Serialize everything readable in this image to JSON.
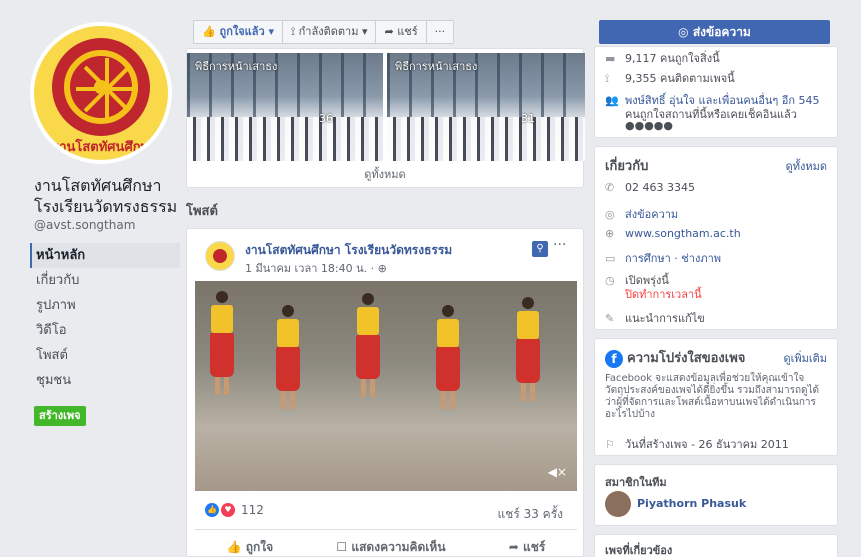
{
  "page": {
    "name_line1": "งานโสตทัศนศึกษา",
    "name_line2": "โรงเรียนวัดทรงธรรม",
    "handle": "@avst.songtham",
    "avatar_caption": "งานโสตทัศนศึกษ"
  },
  "nav": {
    "items": [
      {
        "label": "หน้าหลัก"
      },
      {
        "label": "เกี่ยวกับ"
      },
      {
        "label": "รูปภาพ"
      },
      {
        "label": "วิดีโอ"
      },
      {
        "label": "โพสต์"
      },
      {
        "label": "ชุมชน"
      }
    ],
    "create_page": "สร้างเพจ"
  },
  "action_bar": {
    "liked": "ถูกใจแล้ว ▾",
    "following": "กำลังติดตาม ▾",
    "share": "แชร์",
    "more": "···"
  },
  "photos": {
    "items": [
      {
        "caption": "พิธีการหน้าเสาธง",
        "count": "36"
      },
      {
        "caption": "พิธีการหน้าเสาธง",
        "count": "31"
      }
    ],
    "see_all": "ดูทั้งหมด"
  },
  "posts": {
    "header": "โพสต์",
    "author": "งานโสตทัศนศึกษา โรงเรียนวัดทรงธรรม",
    "time": "1 มีนาคม เวลา 18:40 น. · ",
    "reactions": "112",
    "shares": "แชร์ 33 ครั้ง",
    "actions": [
      "ถูกใจ",
      "แสดงความคิดเห็น",
      "แชร์"
    ]
  },
  "right": {
    "send_message": "ส่งข้อความ",
    "likes": "9,117 คนถูกใจสิ่งนี้",
    "followers": "9,355 คนติดตามเพจนี้",
    "friends_line1": "พงษ์สิทธิ์ อุ่นใจ และเพื่อนคนอื่นๆ อีก 545",
    "friends_line2": "คนถูกใจสถานที่นี้หรือเคยเช็คอินแล้ว",
    "about": {
      "title": "เกี่ยวกับ",
      "see_all": "ดูทั้งหมด",
      "phone": "02 463 3345",
      "message": "ส่งข้อความ",
      "website": "www.songtham.ac.th",
      "category": "การศึกษา · ช่างภาพ",
      "open_now": "เปิดพรุ่งนี้",
      "closed": "ปิดทำการเวลานี้",
      "suggest": "แนะนำการแก้ไข"
    },
    "transparency": {
      "title": "ความโปร่งใสของเพจ",
      "more": "ดูเพิ่มเติม",
      "desc": "Facebook จะแสดงข้อมูลเพื่อช่วยให้คุณเข้าใจวัตถุประสงค์ของเพจได้ดียิ่งขึ้น รวมถึงสามารถดูได้ว่าผู้ที่จัดการและโพสต์เนื้อหาบนเพจได้ดำเนินการอะไรไปบ้าง",
      "created": "วันที่สร้างเพจ - 26 ธันวาคม 2011"
    },
    "members": {
      "title": "สมาชิกในทีม",
      "name": "Piyathorn Phasuk"
    },
    "related": {
      "title": "เพจที่เกี่ยวข้อง"
    }
  },
  "colors": {
    "brand_blue": "#4267b2",
    "link": "#385898",
    "create_green": "#42b72a",
    "closed_red": "#fa3e3e"
  }
}
